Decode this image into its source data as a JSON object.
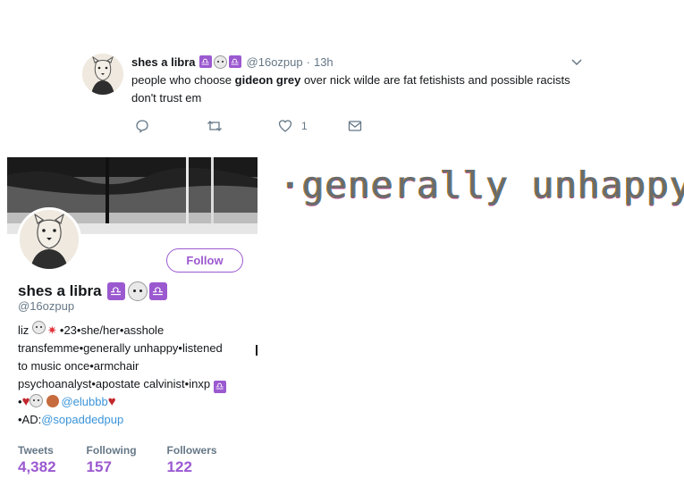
{
  "tweet": {
    "name": "shes a libra",
    "handle": "@16ozpup",
    "time": "13h",
    "text_before": "people who choose ",
    "text_bold": "gideon grey",
    "text_after": " over nick wilde are fat fetishists and possible racists don't trust em",
    "like_count": "1"
  },
  "profile": {
    "follow_label": "Follow",
    "name": "shes a libra",
    "handle": "@16ozpup",
    "bio": {
      "line1_prefix": "liz ",
      "line1_suffix": "•23•she/her•asshole",
      "line2": "transfemme•generally unhappy•listened",
      "line3": "to music once•armchair",
      "line4": "psychoanalyst•apostate calvinist•inxp",
      "line5_prefix": "•",
      "line5_link": "@elubbb",
      "line6_prefix": "•AD:",
      "line6_link": "@sopaddedpup"
    },
    "stats": [
      {
        "label": "Tweets",
        "value": "4,382"
      },
      {
        "label": "Following",
        "value": "157"
      },
      {
        "label": "Followers",
        "value": "122"
      }
    ]
  },
  "overlay_text": "·generally unhappy",
  "colors": {
    "accent": "#9b59d0",
    "link": "#3b94d9",
    "heart": "#c1272d"
  },
  "icons": [
    "reply-icon",
    "retweet-icon",
    "like-icon",
    "message-icon",
    "chevron-down-icon",
    "libra-icon",
    "dog-face-icon",
    "anger-icon",
    "heart-icon",
    "bear-icon"
  ]
}
